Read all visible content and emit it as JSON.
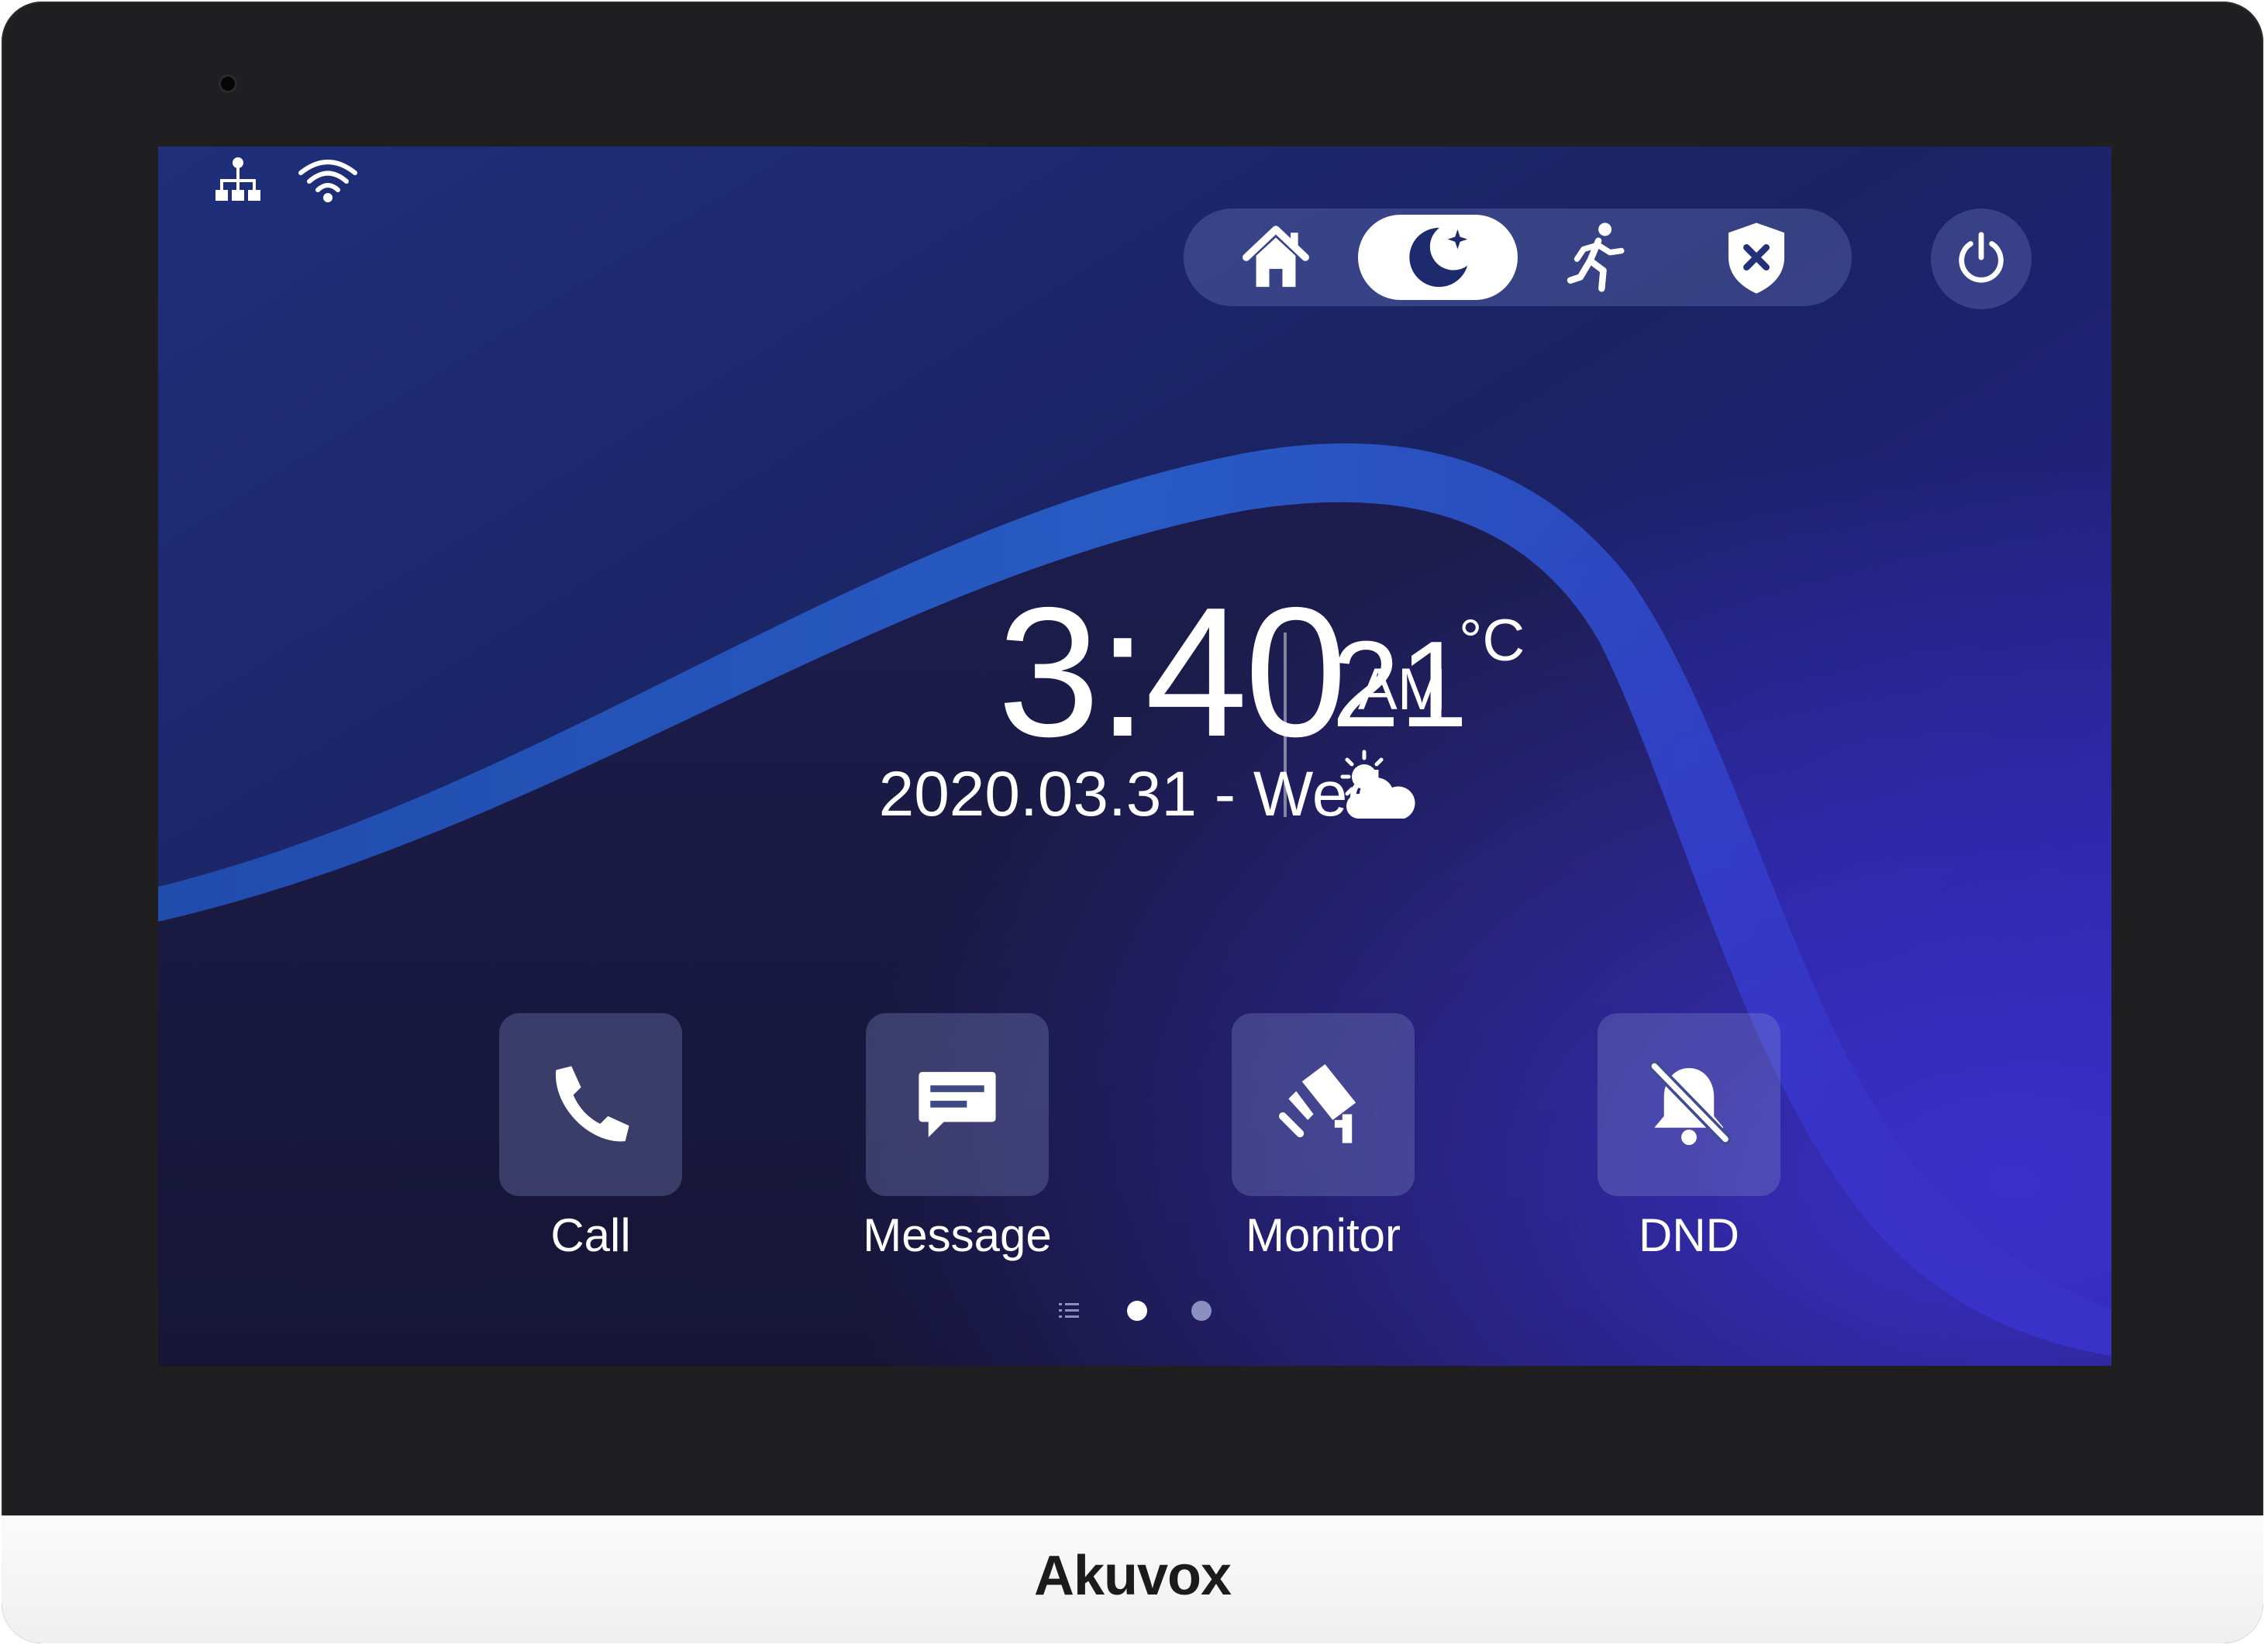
{
  "brand": "Akuvox",
  "status_bar": {
    "icons": [
      "network-icon",
      "wifi-icon"
    ]
  },
  "mode_bar": {
    "modes": [
      {
        "icon": "home-icon",
        "active": false
      },
      {
        "icon": "night-moon-icon",
        "active": true
      },
      {
        "icon": "away-running-icon",
        "active": false
      },
      {
        "icon": "disarm-shield-icon",
        "active": false
      }
    ],
    "power_icon": "power-icon"
  },
  "clock": {
    "time": "3:40",
    "ampm": "AM",
    "date": "2020.03.31 - Wed"
  },
  "weather": {
    "temperature": "21",
    "unit": "°C",
    "icon": "partly-cloudy-icon"
  },
  "apps": [
    {
      "label": "Call",
      "icon": "phone-icon"
    },
    {
      "label": "Message",
      "icon": "message-icon"
    },
    {
      "label": "Monitor",
      "icon": "camera-icon"
    },
    {
      "label": "DND",
      "icon": "bell-off-icon"
    }
  ],
  "pagination": {
    "current_page": 1,
    "page_count": 2
  },
  "colors": {
    "bezel": "#1f1f21",
    "screen_base": "#16173a",
    "accent_blue": "#2f5fd6",
    "active_mode_bg": "#ffffff"
  }
}
